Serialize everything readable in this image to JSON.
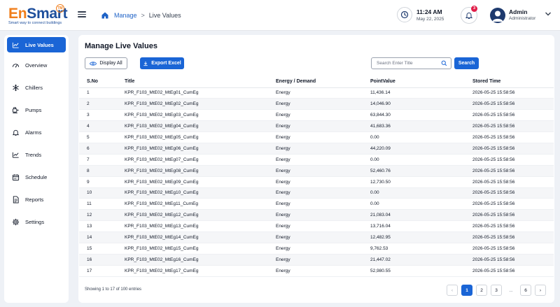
{
  "logo": {
    "part1": "En",
    "part2": "Smart",
    "tm": "TM",
    "tagline": "Smart way to connect buildings"
  },
  "breadcrumb": {
    "link": "Manage",
    "separator": ">",
    "current": "Live Values"
  },
  "clock": {
    "time": "11:24 AM",
    "date": "May 22, 2025"
  },
  "notifications": {
    "count": "3"
  },
  "user": {
    "name": "Admin",
    "role": "Administrator"
  },
  "sidebar": {
    "items": [
      {
        "label": "Live Values",
        "icon": "trend-line-icon"
      },
      {
        "label": "Overview",
        "icon": "gauge-icon"
      },
      {
        "label": "Chillers",
        "icon": "snowflake-icon"
      },
      {
        "label": "Pumps",
        "icon": "pump-icon"
      },
      {
        "label": "Alarms",
        "icon": "bell-icon"
      },
      {
        "label": "Trends",
        "icon": "trend-icon"
      },
      {
        "label": "Schedule",
        "icon": "calendar-icon"
      },
      {
        "label": "Reports",
        "icon": "document-icon"
      },
      {
        "label": "Settings",
        "icon": "gear-icon"
      }
    ]
  },
  "main": {
    "title": "Manage Live Values",
    "display_all": "Display All",
    "export": "Export Excel",
    "search_placeholder": "Search Enter Title",
    "search_button": "Search",
    "columns": [
      "S.No",
      "Title",
      "Energy / Demand",
      "PointValue",
      "Stored Time"
    ],
    "rows": [
      [
        "1",
        "KPR_F103_MtE02_MtEg01_CumEg",
        "Energy",
        "11,436.14",
        "2026-05-25 15:58:56"
      ],
      [
        "2",
        "KPR_F103_MtE02_MtEg02_CumEg",
        "Energy",
        "14,046.90",
        "2026-05-25 15:58:56"
      ],
      [
        "3",
        "KPR_F103_MtE02_MtEg03_CumEg",
        "Energy",
        "63,844.30",
        "2026-05-25 15:58:56"
      ],
      [
        "4",
        "KPR_F103_MtE02_MtEg04_CumEg",
        "Energy",
        "41,683.36",
        "2026-05-25 15:58:56"
      ],
      [
        "5",
        "KPR_F103_MtE02_MtEg05_CumEg",
        "Energy",
        "0.00",
        "2026-05-25 15:58:56"
      ],
      [
        "6",
        "KPR_F103_MtE02_MtEg06_CumEg",
        "Energy",
        "44,220.09",
        "2026-05-25 15:58:56"
      ],
      [
        "7",
        "KPR_F103_MtE02_MtEg07_CumEg",
        "Energy",
        "0.00",
        "2026-05-25 15:58:56"
      ],
      [
        "8",
        "KPR_F103_MtE02_MtEg08_CumEg",
        "Energy",
        "52,460.76",
        "2026-05-25 15:58:56"
      ],
      [
        "9",
        "KPR_F103_MtE02_MtEg09_CumEg",
        "Energy",
        "12,730.50",
        "2026-05-25 15:58:56"
      ],
      [
        "10",
        "KPR_F103_MtE02_MtEg10_CumEg",
        "Energy",
        "0.00",
        "2026-05-25 15:58:56"
      ],
      [
        "11",
        "KPR_F103_MtE02_MtEg11_CumEg",
        "Energy",
        "0.00",
        "2026-05-25 15:58:56"
      ],
      [
        "12",
        "KPR_F103_MtE02_MtEg12_CumEg",
        "Energy",
        "21,083.04",
        "2026-05-25 15:58:56"
      ],
      [
        "13",
        "KPR_F103_MtE02_MtEg13_CumEg",
        "Energy",
        "13,716.04",
        "2026-05-25 15:58:56"
      ],
      [
        "14",
        "KPR_F103_MtE02_MtEg14_CumEg",
        "Energy",
        "12,482.95",
        "2026-05-25 15:58:56"
      ],
      [
        "15",
        "KPR_F103_MtE02_MtEg15_CumEg",
        "Energy",
        "9,762.53",
        "2026-05-25 15:58:56"
      ],
      [
        "16",
        "KPR_F103_MtE02_MtEg16_CumEg",
        "Energy",
        "21,447.02",
        "2026-05-25 15:58:56"
      ],
      [
        "17",
        "KPR_F103_MtE02_MtEg17_CumEg",
        "Energy",
        "52,980.55",
        "2026-05-25 15:58:56"
      ]
    ],
    "entries_text": "Showing 1 to 17 of 100 entries",
    "pagination": {
      "prev": "‹",
      "pages": [
        "1",
        "2",
        "3",
        "...",
        "6"
      ],
      "next": "›",
      "active": "1"
    }
  },
  "colors": {
    "accent": "#1a65d6",
    "brand_orange": "#f07e1b",
    "brand_blue": "#1e4f9c",
    "badge": "#e11d48"
  }
}
